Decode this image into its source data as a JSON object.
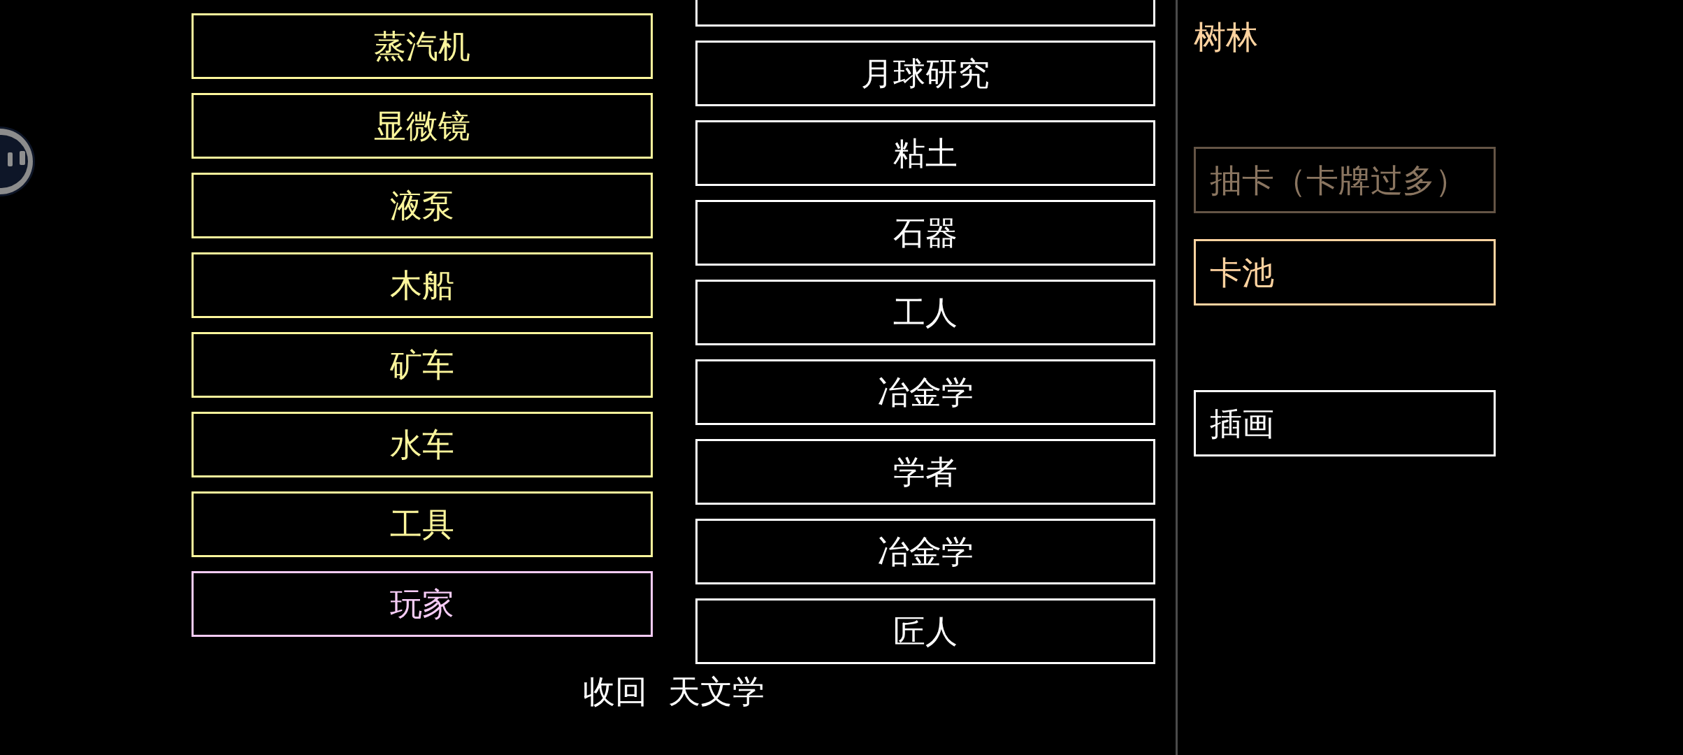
{
  "left_column": {
    "cards": [
      {
        "label": "蒸汽机",
        "color": "#fcf69c"
      },
      {
        "label": "显微镜",
        "color": "#fcf69c"
      },
      {
        "label": "液泵",
        "color": "#fcf69c"
      },
      {
        "label": "木船",
        "color": "#fcf69c"
      },
      {
        "label": "矿车",
        "color": "#fcf69c"
      },
      {
        "label": "水车",
        "color": "#fcf69c"
      },
      {
        "label": "工具",
        "color": "#fcf69c"
      },
      {
        "label": "玩家",
        "color": "#f7ccf7"
      }
    ]
  },
  "middle_column": {
    "cards": [
      {
        "label": "月球研究"
      },
      {
        "label": "粘土"
      },
      {
        "label": "石器"
      },
      {
        "label": "工人"
      },
      {
        "label": "冶金学"
      },
      {
        "label": "学者"
      },
      {
        "label": "冶金学"
      },
      {
        "label": "匠人"
      }
    ]
  },
  "footer": {
    "collapse": "收回",
    "category": "天文学"
  },
  "right_panel": {
    "location": "树林",
    "actions": [
      {
        "label": "抽卡（卡牌过多）",
        "color": "#8a7560",
        "disabled": true
      },
      {
        "label": "卡池",
        "color": "#ffd3a0",
        "disabled": false
      }
    ],
    "gallery_button": {
      "label": "插画",
      "color": "#ffffff",
      "disabled": false
    }
  }
}
